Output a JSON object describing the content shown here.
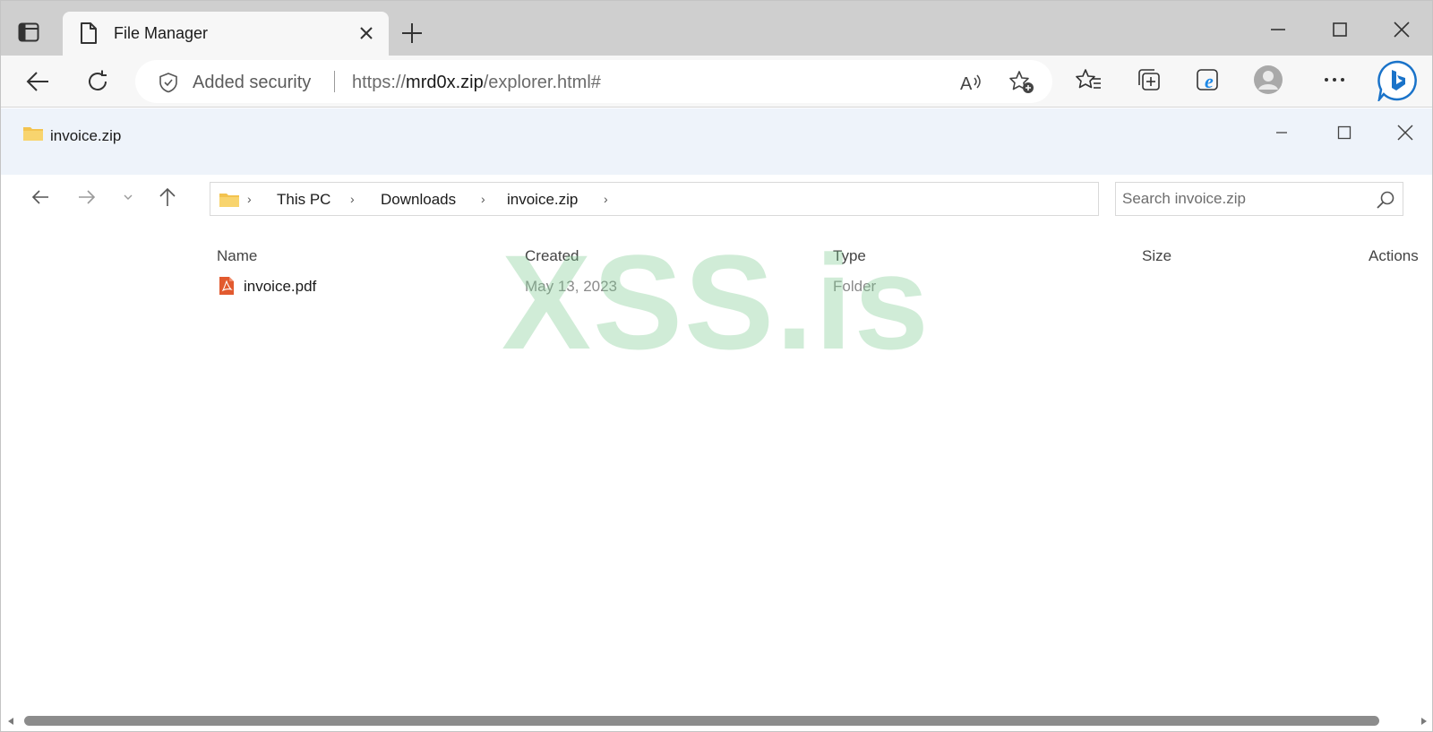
{
  "browser": {
    "tab": {
      "title": "File Manager"
    },
    "address": {
      "security_label": "Added security",
      "url_scheme": "https://",
      "url_host": "mrd0x.zip",
      "url_path": "/explorer.html#"
    },
    "icons": {
      "tab_actions": "tab-actions-icon",
      "page": "page-icon",
      "close": "close-icon",
      "new_tab": "plus-icon",
      "back": "back-arrow-icon",
      "refresh": "refresh-icon",
      "shield": "shield-icon",
      "read_aloud": "read-aloud-icon",
      "add_favorite": "star-add-icon",
      "favorites": "favorites-icon",
      "collections": "collections-icon",
      "ie_mode": "ie-mode-icon",
      "profile": "profile-avatar-icon",
      "more": "more-icon",
      "bing": "bing-chat-icon"
    }
  },
  "app": {
    "title": "invoice.zip",
    "breadcrumb": [
      "This PC",
      "Downloads",
      "invoice.zip"
    ],
    "search": {
      "placeholder": "Search invoice.zip",
      "value": ""
    },
    "columns": {
      "name": "Name",
      "created": "Created",
      "type": "Type",
      "size": "Size",
      "actions": "Actions"
    },
    "files": [
      {
        "name": "invoice.pdf",
        "created": "May 13, 2023",
        "type": "Folder",
        "size": ""
      }
    ]
  },
  "watermark": {
    "text": "XSS.is",
    "color": "#78c88c"
  }
}
